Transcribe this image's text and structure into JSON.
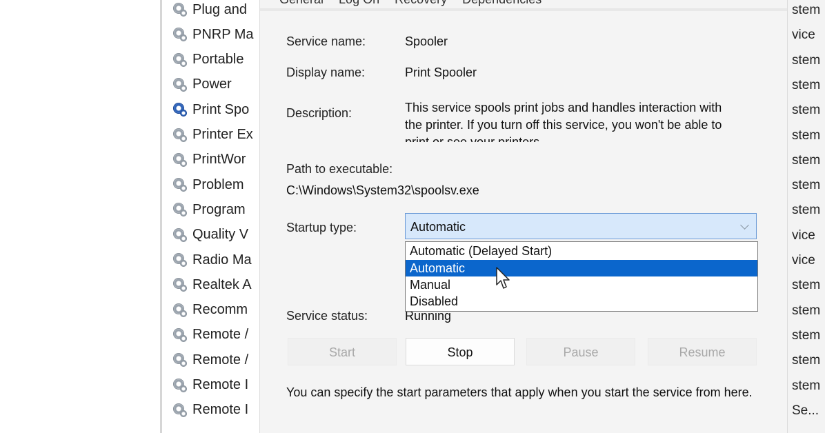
{
  "services_list": {
    "items": [
      {
        "name": "Plug and",
        "active": false
      },
      {
        "name": "PNRP Ma",
        "active": false
      },
      {
        "name": "Portable",
        "active": false
      },
      {
        "name": "Power",
        "active": false
      },
      {
        "name": "Print Spo",
        "active": true
      },
      {
        "name": "Printer Ex",
        "active": false
      },
      {
        "name": "PrintWor",
        "active": false
      },
      {
        "name": "Problem",
        "active": false
      },
      {
        "name": "Program",
        "active": false
      },
      {
        "name": "Quality V",
        "active": false
      },
      {
        "name": "Radio Ma",
        "active": false
      },
      {
        "name": "Realtek A",
        "active": false
      },
      {
        "name": "Recomm",
        "active": false
      },
      {
        "name": "Remote /",
        "active": false
      },
      {
        "name": "Remote /",
        "active": false
      },
      {
        "name": "Remote I",
        "active": false
      },
      {
        "name": "Remote I",
        "active": false
      }
    ],
    "logon_col": [
      "stem",
      "vice",
      "stem",
      "stem",
      "stem",
      "stem",
      "stem",
      "stem",
      "stem",
      "vice",
      "vice",
      "stem",
      "stem",
      "stem",
      "stem",
      "stem",
      "Se..."
    ]
  },
  "dialog": {
    "tabs": [
      "General",
      "Log On",
      "Recovery",
      "Dependencies"
    ],
    "service_name_label": "Service name:",
    "service_name_value": "Spooler",
    "display_name_label": "Display name:",
    "display_name_value": "Print Spooler",
    "description_label": "Description:",
    "description_value": "This service spools print jobs and handles interaction with the printer.  If you turn off this service, you won't be able to print or see your printers.",
    "path_label": "Path to executable:",
    "path_value": "C:\\Windows\\System32\\spoolsv.exe",
    "startup_type_label": "Startup type:",
    "startup_type_value": "Automatic",
    "startup_options": [
      {
        "label": "Automatic (Delayed Start)",
        "selected": false
      },
      {
        "label": "Automatic",
        "selected": true
      },
      {
        "label": "Manual",
        "selected": false
      },
      {
        "label": "Disabled",
        "selected": false
      }
    ],
    "service_status_label": "Service status:",
    "service_status_value": "Running",
    "buttons": {
      "start": "Start",
      "stop": "Stop",
      "pause": "Pause",
      "resume": "Resume"
    },
    "hint": "You can specify the start parameters that apply when you start the service from here."
  },
  "colors": {
    "selection": "#0b66cc",
    "select_bg": "#d7e8fb",
    "select_border": "#6b9ad6"
  }
}
